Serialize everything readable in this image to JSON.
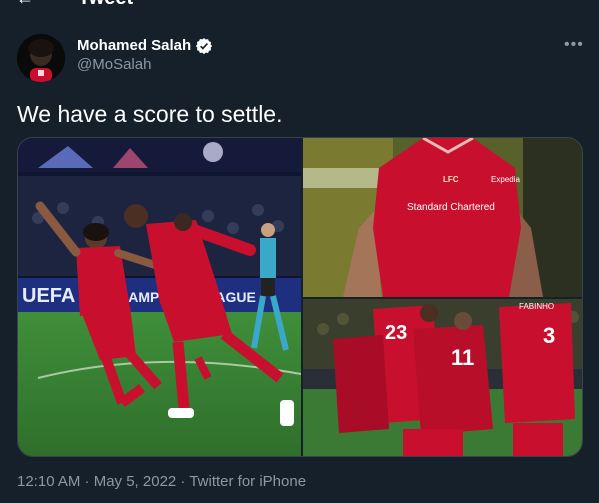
{
  "header": {
    "back_icon": "arrow-left-icon",
    "title": "Tweet"
  },
  "author": {
    "display_name": "Mohamed Salah",
    "handle": "@MoSalah",
    "verified_icon": "verified-badge-icon"
  },
  "more_icon": "more-icon",
  "tweet": {
    "text": "We have a score to settle."
  },
  "media": {
    "images": [
      {
        "name": "celebration-photo",
        "banner_text": "UEFA",
        "champions_text": "CHAMPIONS LEAGUE"
      },
      {
        "name": "kit-closeup-photo",
        "sponsor_text": "Standard Chartered",
        "crest_text": "LFC",
        "expedia_text": "Expedia"
      },
      {
        "name": "team-huddle-photo",
        "numbers": [
          "23",
          "11",
          "3"
        ],
        "player_name": "FABINHO"
      }
    ]
  },
  "footer": {
    "timestamp": "12:10 AM · May 5, 2022 · Twitter for iPhone"
  },
  "colors": {
    "background": "#15202b",
    "muted": "#8b98a5",
    "kit_red": "#c8102e"
  }
}
